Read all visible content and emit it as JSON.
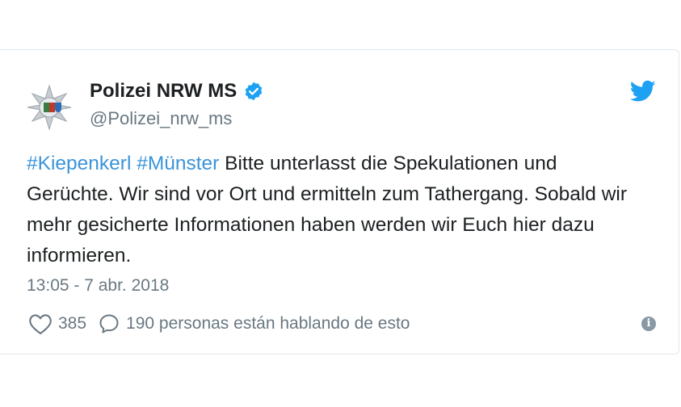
{
  "tweet": {
    "display_name": "Polizei NRW MS",
    "handle": "@Polizei_nrw_ms",
    "verified": true,
    "hashtags": [
      "#Kiepenkerl",
      "#Münster"
    ],
    "body_text": " Bitte unterlasst die Spekulationen und Gerüchte. Wir sind vor Ort und ermitteln zum Tathergang. Sobald wir mehr gesicherte Informationen haben werden wir Euch hier dazu informieren.",
    "timestamp": "13:05 - 7 abr. 2018",
    "likes": "385",
    "conversation_text": "190 personas están hablando de esto",
    "info_symbol": "i"
  },
  "icons": {
    "brand": "twitter-bird-icon",
    "verified": "verified-badge-icon",
    "like": "heart-icon",
    "reply": "speech-bubble-icon",
    "info": "info-icon"
  },
  "colors": {
    "link": "#3b94d9",
    "brand_blue": "#1da1f2",
    "text": "#1c2022",
    "secondary": "#697882",
    "border": "#e1e8ed"
  }
}
